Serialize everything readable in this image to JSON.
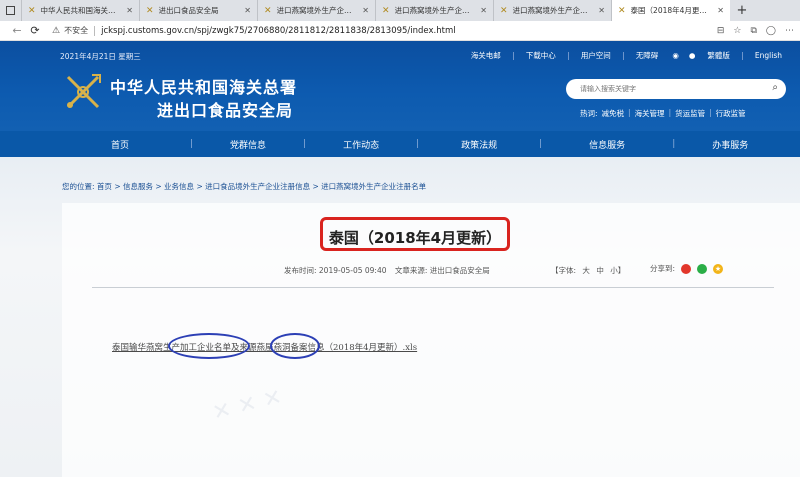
{
  "browser": {
    "tabs": [
      {
        "label": "中华人民共和国海关总署",
        "active": false
      },
      {
        "label": "进出口食品安全局",
        "active": false
      },
      {
        "label": "进口燕窝境外生产企业注",
        "active": false
      },
      {
        "label": "进口燕窝境外生产企业注",
        "active": false
      },
      {
        "label": "进口燕窝境外生产企业注",
        "active": false
      },
      {
        "label": "泰国（2018年4月更新）",
        "active": true
      }
    ],
    "security_label": "不安全",
    "url": "jckspj.customs.gov.cn/spj/zwgk75/2706880/2811812/2811838/2813095/index.html"
  },
  "header": {
    "date": "2021年4月21日 星期三",
    "top_links": [
      "海关电邮",
      "下载中心",
      "用户空间",
      "无障碍",
      "繁體版",
      "English"
    ],
    "title_line1": "中华人民共和国海关总署",
    "title_line2": "进出口食品安全局",
    "search_placeholder": "请输入搜索关键字",
    "hot_label": "热词:",
    "hot_words": [
      "减免税",
      "海关管理",
      "货运监管",
      "行政监管"
    ]
  },
  "nav": [
    "首页",
    "党群信息",
    "工作动态",
    "政策法规",
    "信息服务",
    "办事服务"
  ],
  "breadcrumb": {
    "prefix": "您的位置:",
    "items": [
      "首页",
      "信息服务",
      "业务信息",
      "进口食品境外生产企业注册信息",
      "进口燕窝境外生产企业注册名单"
    ],
    "separator": " > "
  },
  "article": {
    "title": "泰国（2018年4月更新）",
    "published": "发布时间: 2019-05-05 09:40",
    "source": "文章来源: 进出口食品安全局",
    "font_label": "【字体:",
    "font_large": "大",
    "font_medium": "中",
    "font_small": "小】",
    "share_label": "分享到:",
    "attachment": "泰国输华燕窝生产加工企业名单及来源燕屋燕洞备案信息（2018年4月更新）.xls"
  },
  "colors": {
    "header_blue": "#0d5bb0",
    "highlight_red": "#d9241f",
    "highlight_blue": "#2c3fb5"
  }
}
